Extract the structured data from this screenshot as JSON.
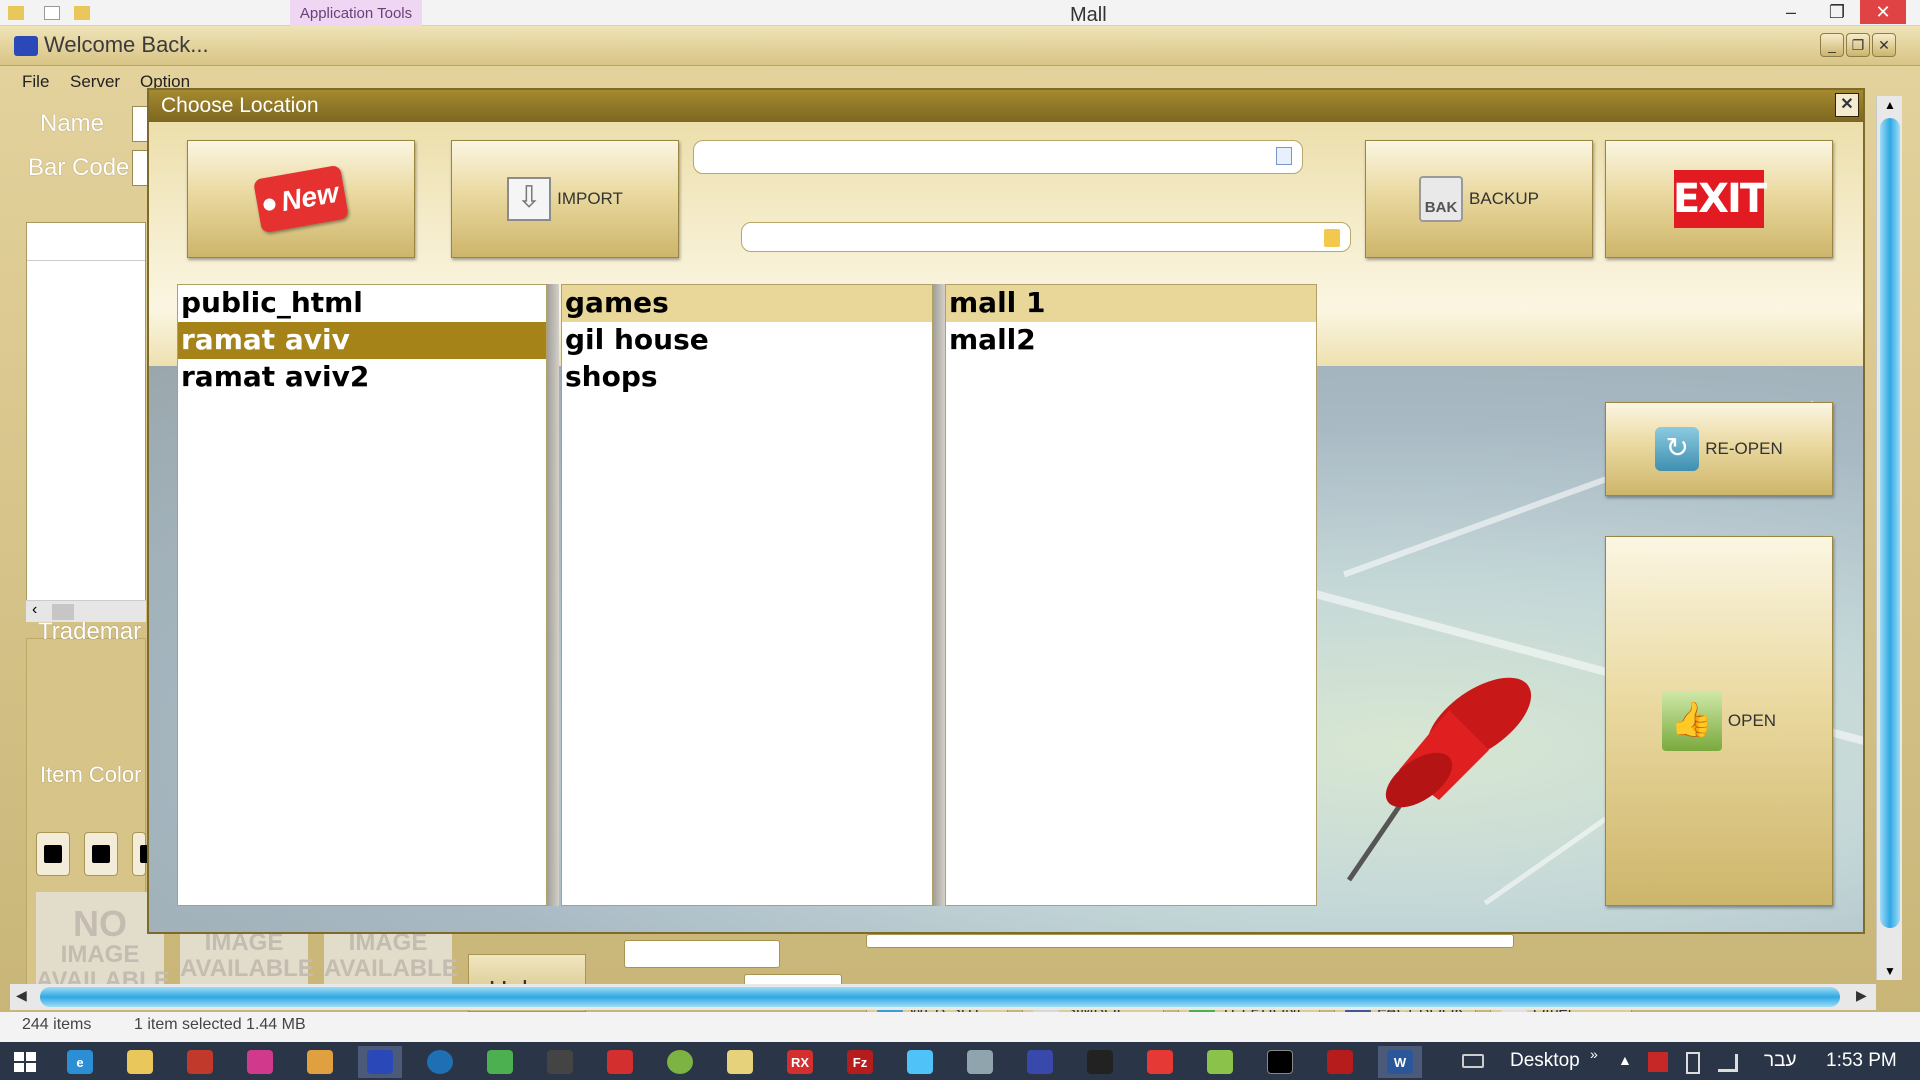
{
  "explorer": {
    "app_tools": "Application Tools",
    "title": "Mall"
  },
  "back_window": {
    "title": "Welcome Back...",
    "menu": [
      "File",
      "Server",
      "Option"
    ],
    "labels": {
      "name": "Name",
      "bar_code": "Bar Code",
      "trademark": "Trademar",
      "item_color": "Item Color"
    },
    "no_image": {
      "line1": "NO",
      "line2": "IMAGE",
      "line3": "AVAILABLE"
    },
    "image": {
      "line2": "IMAGE",
      "line3": "AVAILABLE"
    },
    "helper": "Helper",
    "social": [
      "WEB SITE",
      "SIMBOL",
      "TELPHONE",
      "FACEBOOK",
      "Other"
    ]
  },
  "status": {
    "items": "244 items",
    "selected": "1 item selected  1.44 MB"
  },
  "dialog": {
    "title": "Choose Location",
    "buttons": {
      "new": "New",
      "import": "IMPORT",
      "backup": "BACKUP",
      "bak": "BAK",
      "exit": "EXIT",
      "reopen": "RE-OPEN",
      "open": "OPEN"
    },
    "path_top": "",
    "path_bottom": "",
    "list1": [
      "public_html",
      "ramat aviv",
      "ramat aviv2"
    ],
    "list2": [
      "games",
      "gil house",
      "shops"
    ],
    "list3": [
      "mall 1",
      "mall2"
    ]
  },
  "taskbar": {
    "desktop": "Desktop",
    "lang": "עבר",
    "time": "1:53 PM",
    "rx": "RX",
    "fz": "Fz",
    "word": "W"
  },
  "colors": {
    "dialog_title": "#8c7424",
    "selection": "#a58318",
    "highlight": "#e8d799",
    "taskbar": "#2a3548"
  }
}
